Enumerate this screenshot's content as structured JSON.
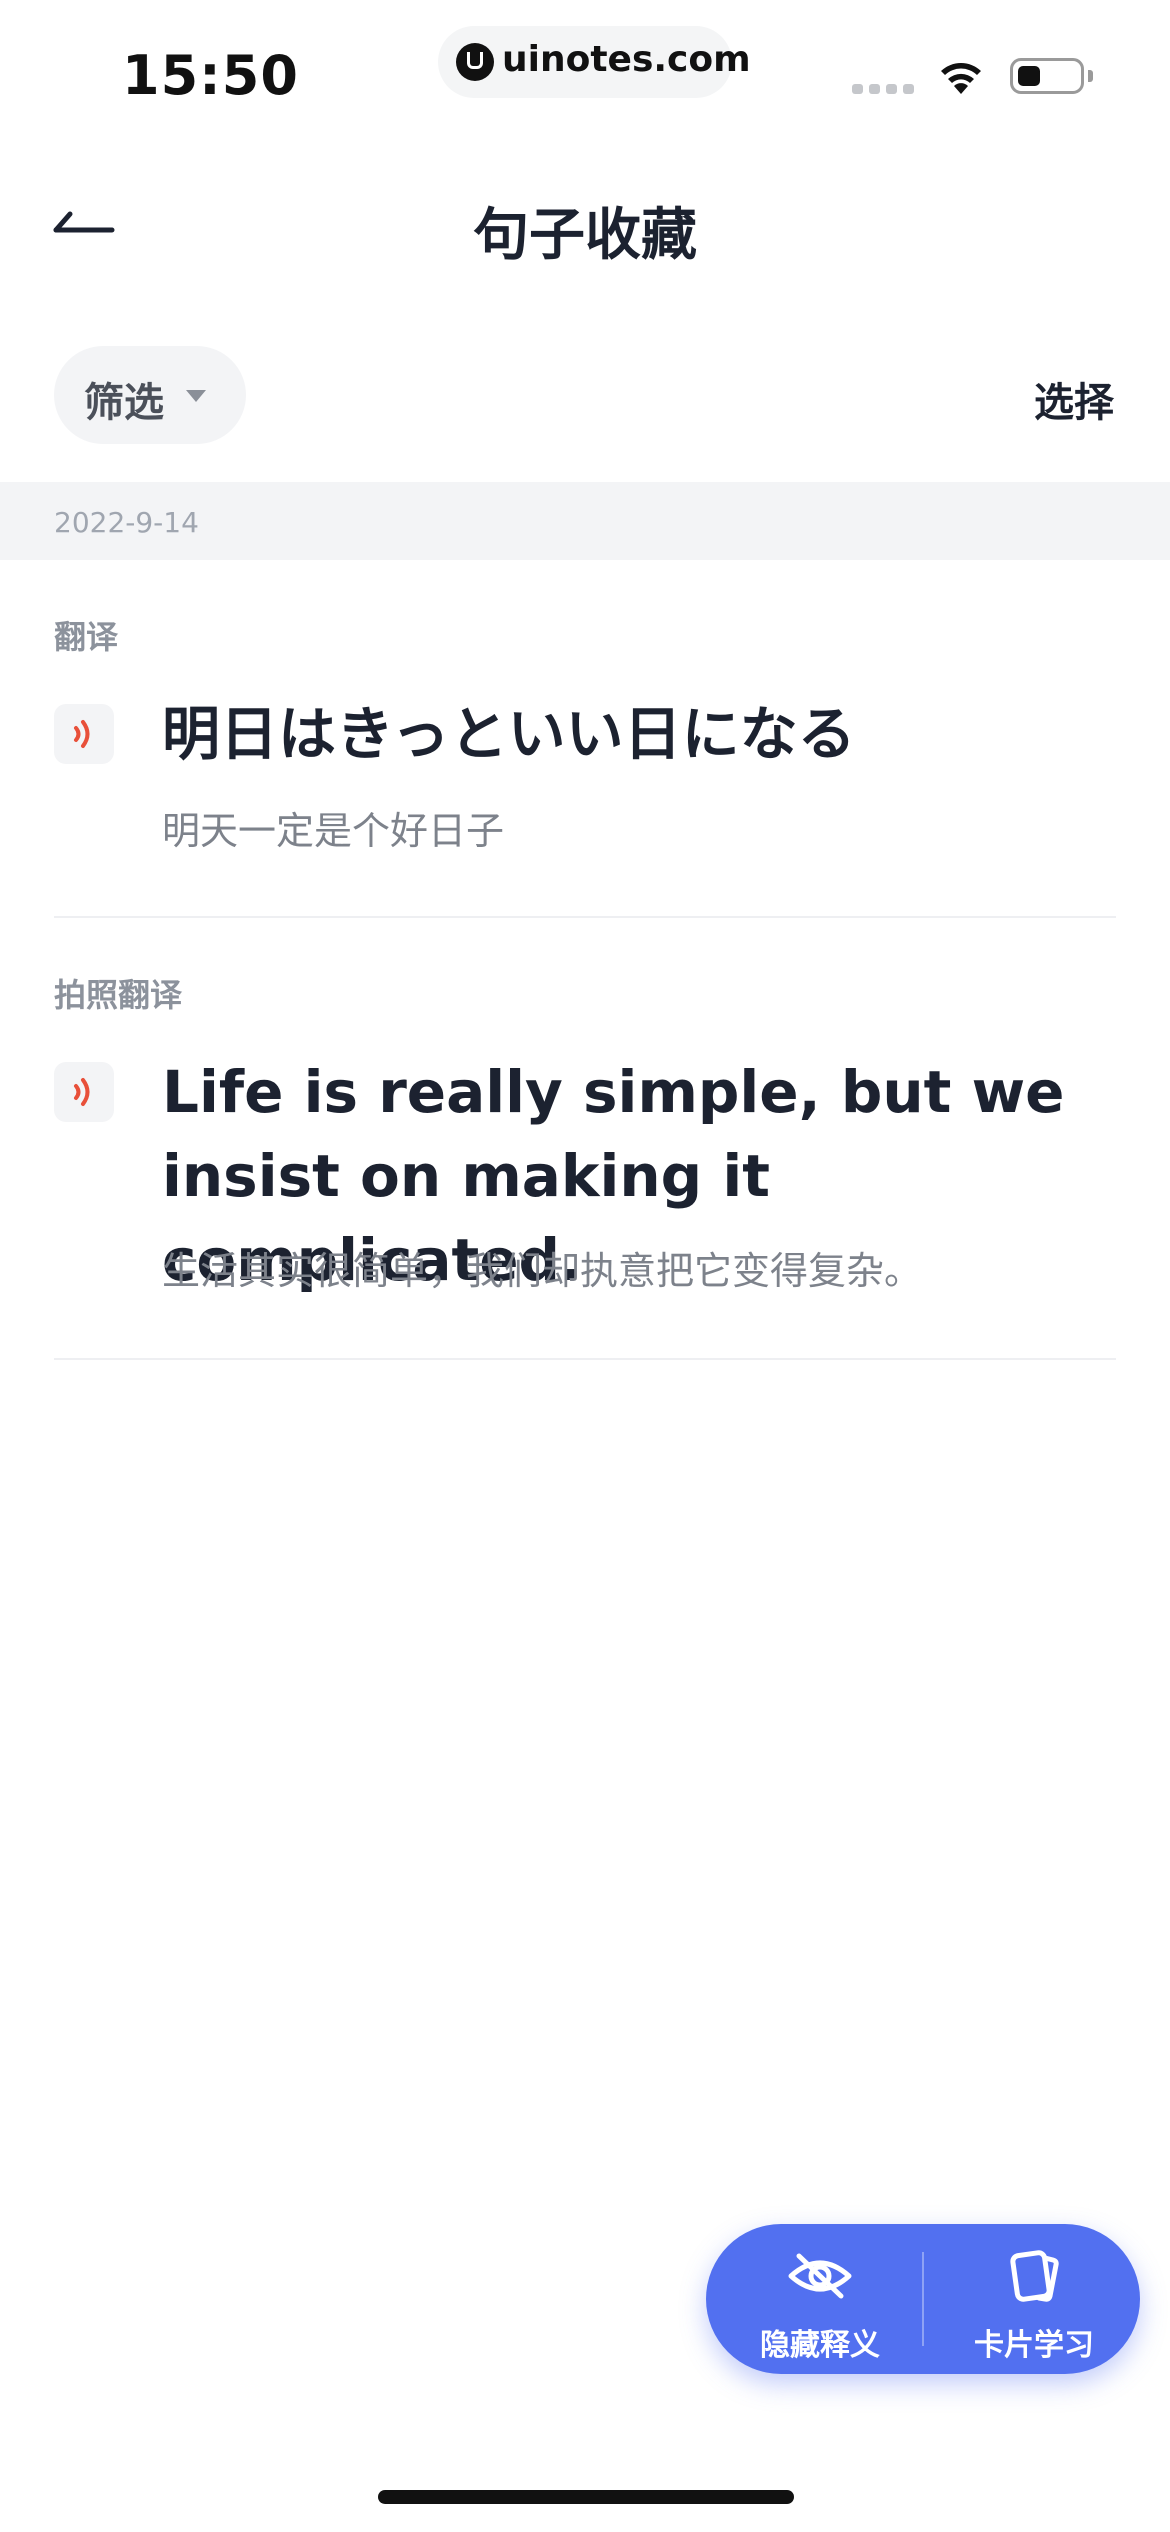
{
  "status_bar": {
    "time": "15:50",
    "url": "uinotes.com",
    "icons": [
      "signal-icon",
      "wifi-icon",
      "battery-icon"
    ]
  },
  "nav": {
    "title": "句子收藏",
    "back_icon": "back-arrow-icon"
  },
  "toolbar": {
    "filter_label": "筛选",
    "select_label": "选择"
  },
  "date_group": {
    "date": "2022-9-14"
  },
  "entries": [
    {
      "type": "翻译",
      "sentence": "明日はきっといい日になる",
      "translation": "明天一定是个好日子"
    },
    {
      "type": "拍照翻译",
      "sentence": "Life is really simple, but we insist on making it complicated.",
      "translation": "生活其实很简单，我们却执意把它变得复杂。"
    }
  ],
  "fab": {
    "hide_label": "隐藏释义",
    "cards_label": "卡片学习"
  },
  "colors": {
    "accent": "#5270f0",
    "speaker": "#e8503a",
    "text_primary": "#1c2230",
    "text_secondary": "#7d828b"
  }
}
